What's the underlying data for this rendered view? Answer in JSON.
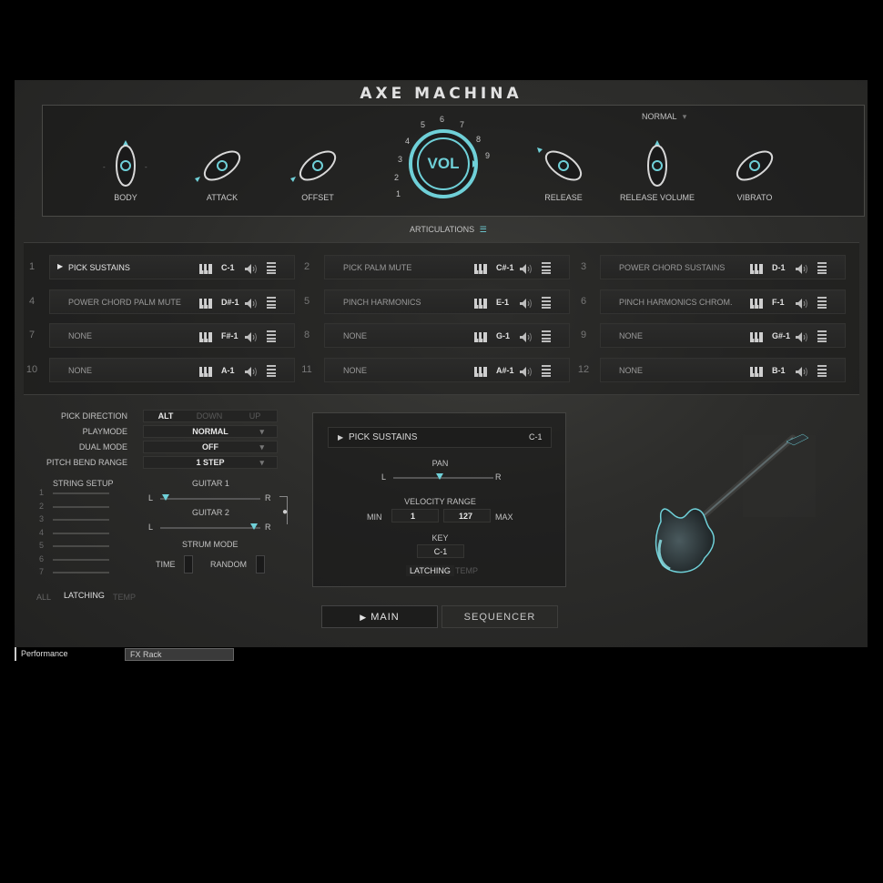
{
  "plugin": {
    "title": "AXE MACHINA",
    "mode_select": "NORMAL",
    "knobs": [
      {
        "label": "BODY"
      },
      {
        "label": "ATTACK"
      },
      {
        "label": "OFFSET"
      },
      {
        "label": "RELEASE"
      },
      {
        "label": "RELEASE VOLUME"
      },
      {
        "label": "VIBRATO"
      }
    ],
    "vol_label": "VOL",
    "vol_scale": [
      "1",
      "2",
      "3",
      "4",
      "5",
      "6",
      "7",
      "8",
      "9"
    ],
    "articulations_label": "ARTICULATIONS"
  },
  "articulations": [
    {
      "num": "1",
      "name": "PICK SUSTAINS",
      "note": "C-1"
    },
    {
      "num": "2",
      "name": "PICK PALM MUTE",
      "note": "C#-1"
    },
    {
      "num": "3",
      "name": "POWER CHORD SUSTAINS",
      "note": "D-1"
    },
    {
      "num": "4",
      "name": "POWER CHORD PALM MUTE",
      "note": "D#-1"
    },
    {
      "num": "5",
      "name": "PINCH HARMONICS",
      "note": "E-1"
    },
    {
      "num": "6",
      "name": "PINCH HARMONICS CHROM.",
      "note": "F-1"
    },
    {
      "num": "7",
      "name": "NONE",
      "note": "F#-1"
    },
    {
      "num": "8",
      "name": "NONE",
      "note": "G-1"
    },
    {
      "num": "9",
      "name": "NONE",
      "note": "G#-1"
    },
    {
      "num": "10",
      "name": "NONE",
      "note": "A-1"
    },
    {
      "num": "11",
      "name": "NONE",
      "note": "A#-1"
    },
    {
      "num": "12",
      "name": "NONE",
      "note": "B-1"
    }
  ],
  "settings": {
    "pick_direction": {
      "label": "PICK DIRECTION",
      "options": [
        "ALT",
        "DOWN",
        "UP"
      ]
    },
    "playmode": {
      "label": "PLAYMODE",
      "value": "NORMAL"
    },
    "dual_mode": {
      "label": "DUAL MODE",
      "value": "OFF"
    },
    "pitch_bend": {
      "label": "PITCH BEND RANGE",
      "value": "1 STEP"
    },
    "string_setup": {
      "label": "STRING SETUP",
      "strings": [
        "1",
        "2",
        "3",
        "4",
        "5",
        "6",
        "7"
      ]
    },
    "guitar1": {
      "label": "GUITAR 1",
      "left": "L",
      "right": "R"
    },
    "guitar2": {
      "label": "GUITAR 2",
      "left": "L",
      "right": "R"
    },
    "strum_mode": {
      "label": "STRUM MODE",
      "time": "TIME",
      "random": "RANDOM"
    },
    "bottom": {
      "all": "ALL",
      "latching": "LATCHING",
      "temp": "TEMP"
    }
  },
  "detail": {
    "name": "PICK SUSTAINS",
    "note": "C-1",
    "pan": {
      "label": "PAN",
      "left": "L",
      "right": "R"
    },
    "velocity": {
      "label": "VELOCITY RANGE",
      "min_label": "MIN",
      "min": "1",
      "max": "127",
      "max_label": "MAX"
    },
    "key": {
      "label": "KEY",
      "value": "C-1"
    },
    "latching": "LATCHING",
    "temp": "TEMP"
  },
  "tabs": {
    "main": "MAIN",
    "sequencer": "SEQUENCER"
  },
  "taskbar": {
    "performance": "Performance",
    "fx_rack": "FX Rack"
  },
  "colors": {
    "accent": "#6fd0d8",
    "bg": "#2d2d2b"
  }
}
